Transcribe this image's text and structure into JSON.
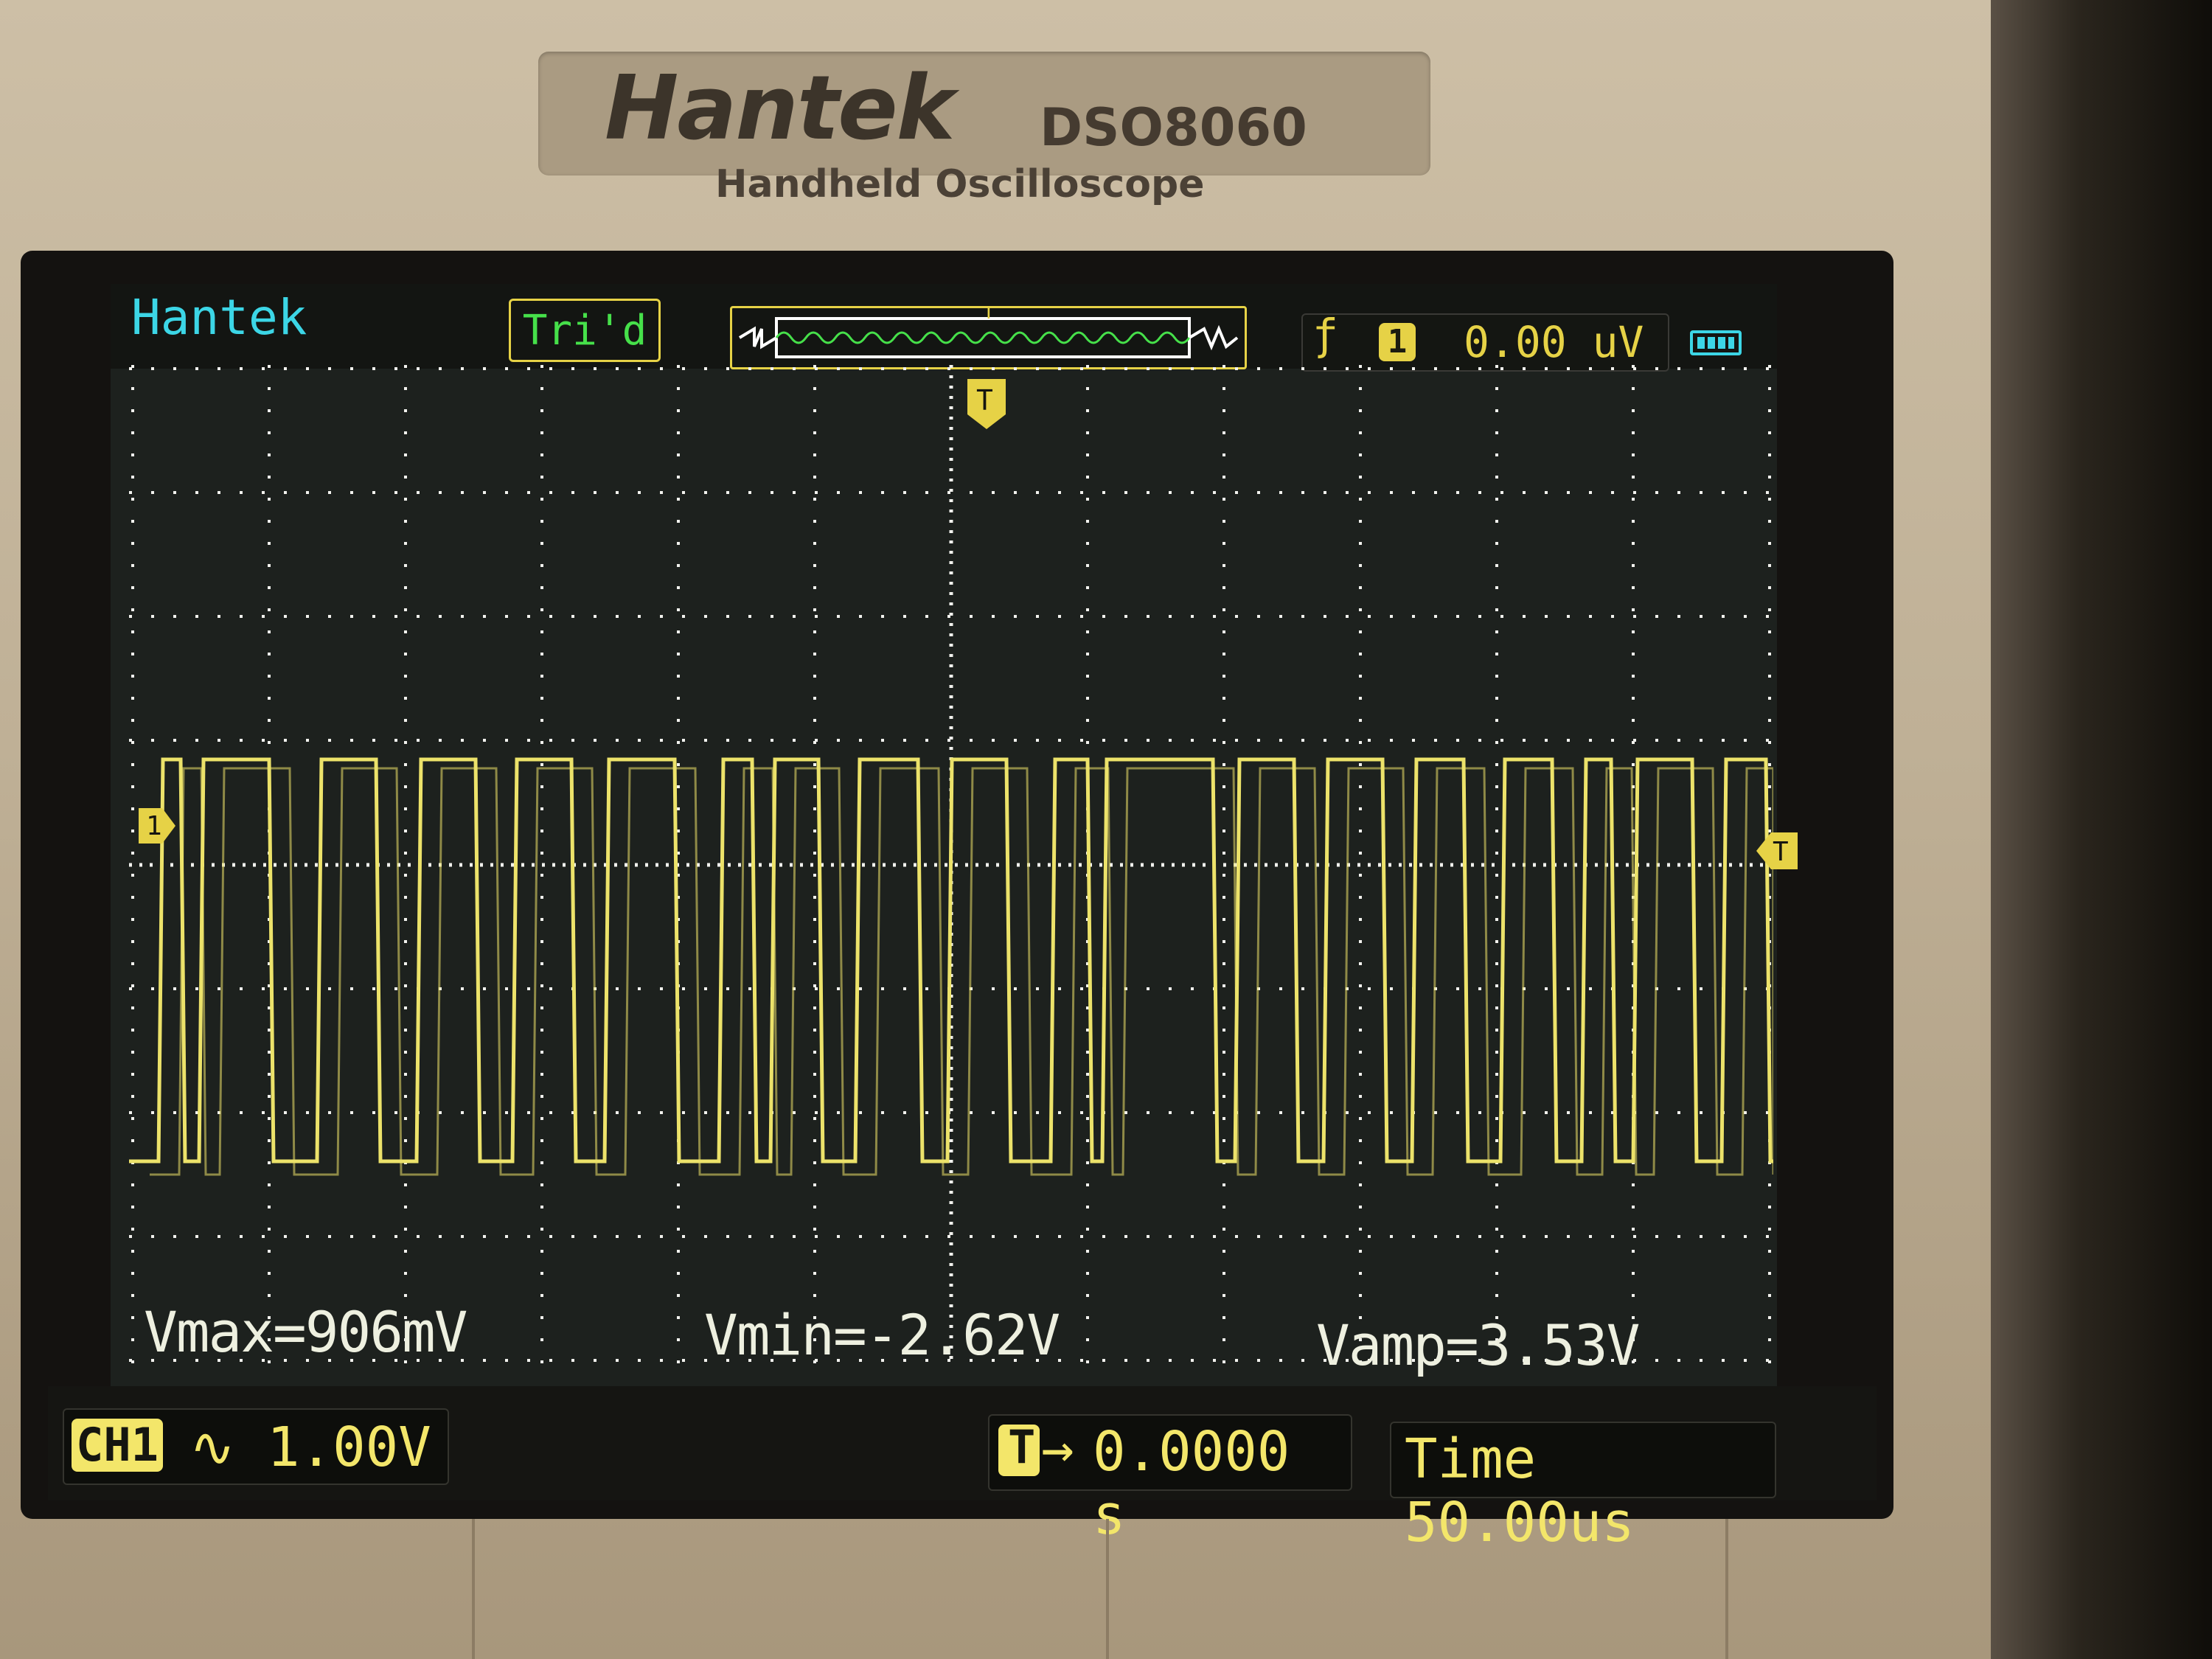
{
  "device": {
    "brand": "Hantek",
    "model": "DSO8060",
    "subtitle": "Handheld Oscilloscope"
  },
  "screen": {
    "logo": "Hantek",
    "status": "Tri'd",
    "trigger": {
      "edge_icon": "rising-edge-icon",
      "channel": "1",
      "level": "0.00 uV"
    },
    "battery_icon": "battery-icon",
    "markers": {
      "channel_marker": "1",
      "trigger_position_marker": "T",
      "trigger_level_marker": "T"
    },
    "measurements": {
      "vmax": "Vmax=906mV",
      "vmin": "Vmin=-2.62V",
      "vamp": "Vamp=3.53V"
    },
    "channel": {
      "tag": "CH1",
      "coupling_icon": "ac-coupling-icon",
      "coupling_glyph": "∿",
      "scale": "1.00V"
    },
    "trigger_position": {
      "arrow": "→",
      "value": "0.0000 s"
    },
    "timebase": "Time 50.00us"
  },
  "colors": {
    "trace": "#ece26a",
    "grid": "#f2f2ee",
    "logo": "#3cd6e6",
    "status": "#46e04a",
    "accent": "#e6d246"
  }
}
